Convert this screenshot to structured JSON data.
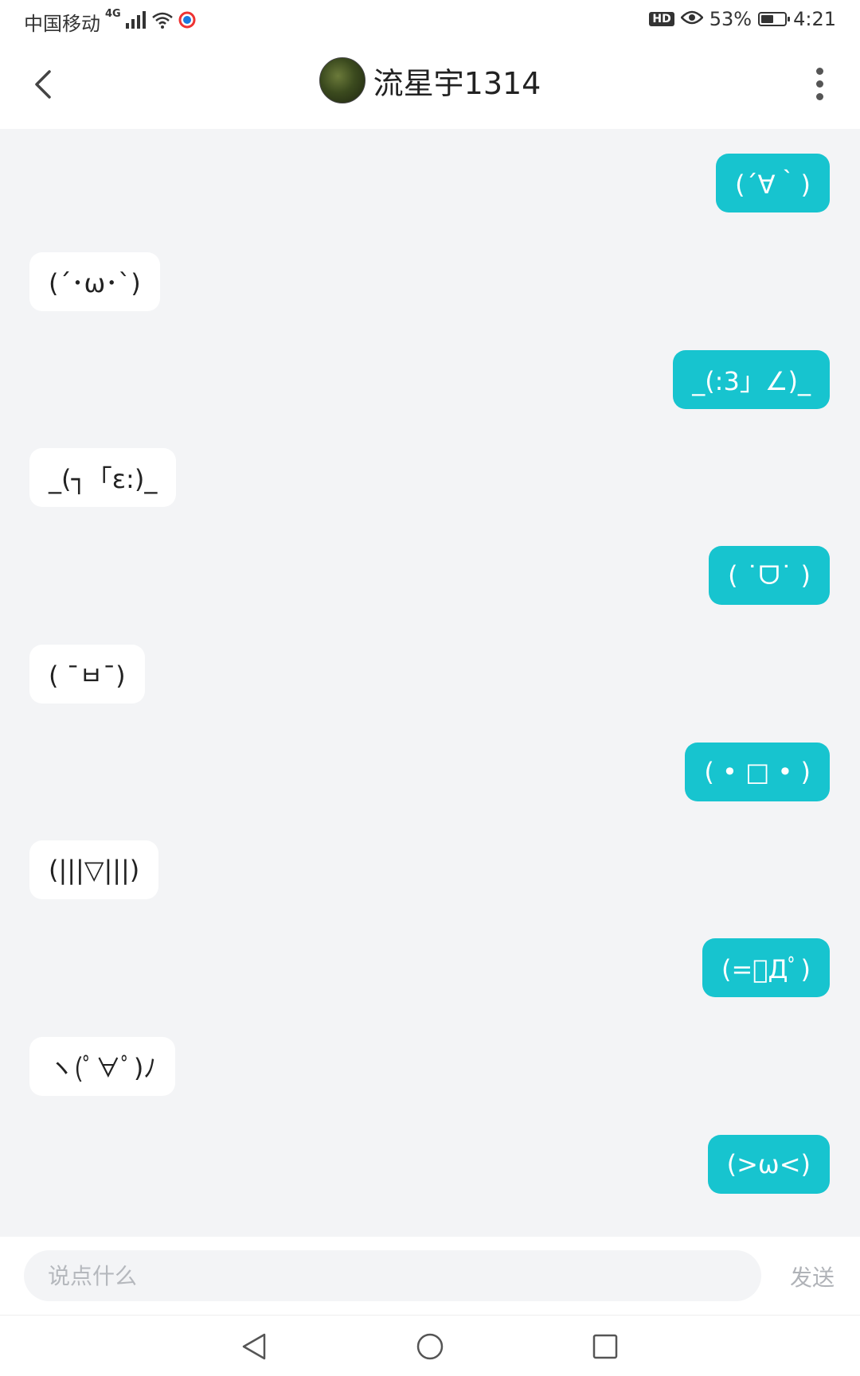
{
  "status_bar": {
    "carrier": "中国移动",
    "network": "4G",
    "hd_label": "HD",
    "battery": "53%",
    "battery_level": 0.53,
    "time": "4:21"
  },
  "header": {
    "title": "流星宇1314"
  },
  "messages": [
    {
      "side": "sent",
      "text": "(´∀｀)"
    },
    {
      "side": "recv",
      "text": "(´･ω･`)"
    },
    {
      "side": "sent",
      "text": "_(:3」∠)_"
    },
    {
      "side": "recv",
      "text": "_(┐「ε:)_"
    },
    {
      "side": "sent",
      "text": "( ˙ᗜ˙ )"
    },
    {
      "side": "recv",
      "text": "( ¯ㅂ¯)"
    },
    {
      "side": "sent",
      "text": "( • □ • )"
    },
    {
      "side": "recv",
      "text": "(|||▽|||)"
    },
    {
      "side": "sent",
      "text": "(=ﾟДﾟ)"
    },
    {
      "side": "recv",
      "text": "ヽ(ﾟ∀ﾟ)ﾉ"
    },
    {
      "side": "sent",
      "text": "(>ω<)"
    }
  ],
  "input": {
    "placeholder": "说点什么",
    "value": ""
  },
  "send_label": "发送",
  "colors": {
    "accent": "#17c4cf",
    "chat_background": "#f3f4f6"
  }
}
